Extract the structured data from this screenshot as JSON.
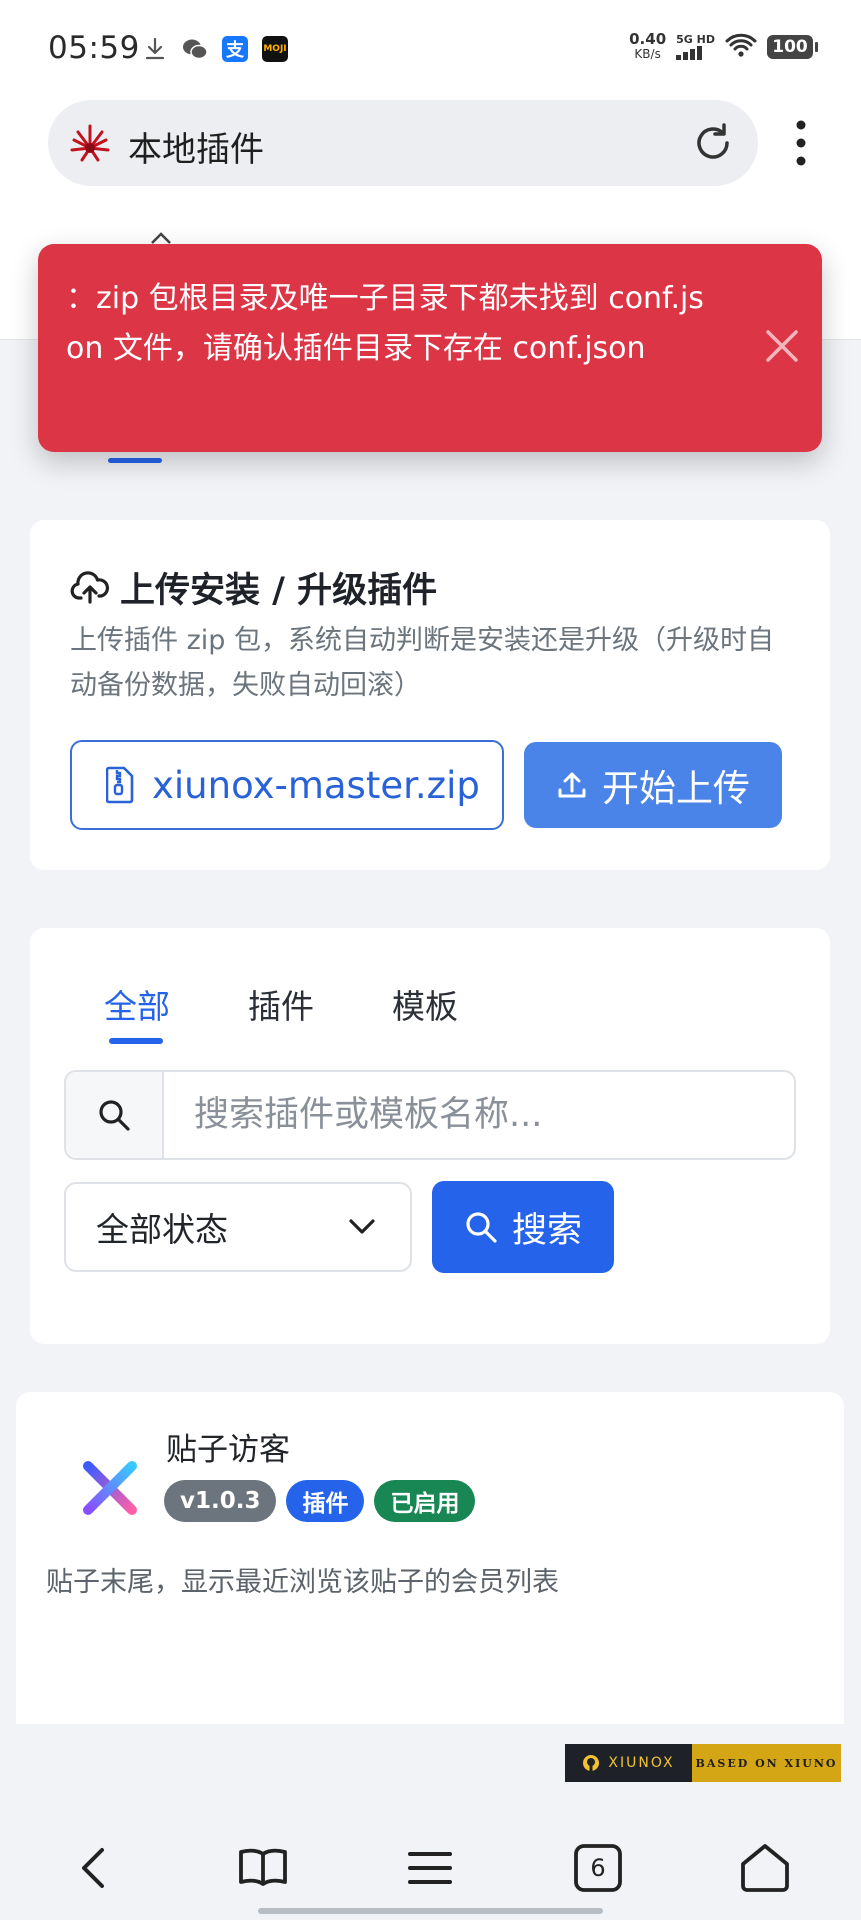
{
  "status_bar": {
    "time": "05:59",
    "net_speed_value": "0.40",
    "net_speed_unit": "KB/s",
    "network": "5G HD",
    "battery": "100"
  },
  "browser": {
    "page_title": "本地插件",
    "tab_count": "6"
  },
  "toast": {
    "message": "：zip 包根目录及唯一子目录下都未找到 conf.json 文件，请确认插件目录下存在 conf.json"
  },
  "upload": {
    "title": "上传安装 / 升级插件",
    "description": "上传插件 zip 包，系统自动判断是安装还是升级（升级时自动备份数据，失败自动回滚）",
    "selected_file": "xiunox-master.zip",
    "upload_button": "开始上传"
  },
  "filter": {
    "tabs": [
      "全部",
      "插件",
      "模板"
    ],
    "active_tab": 0,
    "search_placeholder": "搜索插件或模板名称...",
    "status_select": "全部状态",
    "search_button": "搜索"
  },
  "plugin": {
    "name": "贴子访客",
    "version": "v1.0.3",
    "type": "插件",
    "status": "已启用",
    "description": "贴子末尾，显示最近浏览该贴子的会员列表"
  },
  "footer": {
    "badge_left": "XIUNOX",
    "badge_right": "BASED ON XIUNO"
  },
  "colors": {
    "primary": "#2563eb",
    "danger": "#dc3545",
    "success": "#198754",
    "secondary": "#6c757d"
  }
}
